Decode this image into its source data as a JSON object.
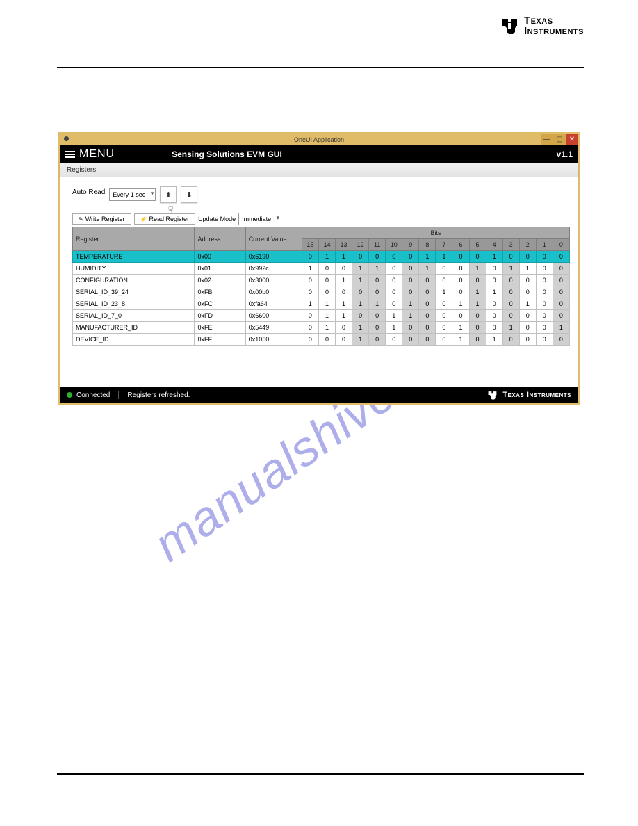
{
  "brand": {
    "line1": "Texas",
    "line2": "Instruments",
    "footer": "Texas Instruments"
  },
  "watermark": "manualshive.com",
  "window_title": "OneUI Application",
  "app_header": {
    "menu": "MENU",
    "title": "Sensing Solutions EVM GUI",
    "version": "v1.1"
  },
  "subheader": "Registers",
  "controls": {
    "autoread_label": "Auto Read",
    "autoread_value": "Every 1 sec",
    "write_btn": "Write Register",
    "read_btn": "Read Register",
    "update_mode_label": "Update Mode",
    "update_mode_value": "Immediate"
  },
  "columns": {
    "register": "Register",
    "address": "Address",
    "current": "Current Value",
    "bits": "Bits"
  },
  "bit_numbers": [
    "15",
    "14",
    "13",
    "12",
    "11",
    "10",
    "9",
    "8",
    "7",
    "6",
    "5",
    "4",
    "3",
    "2",
    "1",
    "0"
  ],
  "rows": [
    {
      "name": "TEMPERATURE",
      "addr": "0x00",
      "val": "0x6190",
      "bits": [
        "0",
        "1",
        "1",
        "0",
        "0",
        "0",
        "0",
        "1",
        "1",
        "0",
        "0",
        "1",
        "0",
        "0",
        "0",
        "0"
      ],
      "hl": true
    },
    {
      "name": "HUMIDITY",
      "addr": "0x01",
      "val": "0x992c",
      "bits": [
        "1",
        "0",
        "0",
        "1",
        "1",
        "0",
        "0",
        "1",
        "0",
        "0",
        "1",
        "0",
        "1",
        "1",
        "0",
        "0"
      ]
    },
    {
      "name": "CONFIGURATION",
      "addr": "0x02",
      "val": "0x3000",
      "bits": [
        "0",
        "0",
        "1",
        "1",
        "0",
        "0",
        "0",
        "0",
        "0",
        "0",
        "0",
        "0",
        "0",
        "0",
        "0",
        "0"
      ]
    },
    {
      "name": "SERIAL_ID_39_24",
      "addr": "0xFB",
      "val": "0x00b0",
      "bits": [
        "0",
        "0",
        "0",
        "0",
        "0",
        "0",
        "0",
        "0",
        "1",
        "0",
        "1",
        "1",
        "0",
        "0",
        "0",
        "0"
      ]
    },
    {
      "name": "SERIAL_ID_23_8",
      "addr": "0xFC",
      "val": "0xfa64",
      "bits": [
        "1",
        "1",
        "1",
        "1",
        "1",
        "0",
        "1",
        "0",
        "0",
        "1",
        "1",
        "0",
        "0",
        "1",
        "0",
        "0"
      ]
    },
    {
      "name": "SERIAL_ID_7_0",
      "addr": "0xFD",
      "val": "0x6600",
      "bits": [
        "0",
        "1",
        "1",
        "0",
        "0",
        "1",
        "1",
        "0",
        "0",
        "0",
        "0",
        "0",
        "0",
        "0",
        "0",
        "0"
      ]
    },
    {
      "name": "MANUFACTURER_ID",
      "addr": "0xFE",
      "val": "0x5449",
      "bits": [
        "0",
        "1",
        "0",
        "1",
        "0",
        "1",
        "0",
        "0",
        "0",
        "1",
        "0",
        "0",
        "1",
        "0",
        "0",
        "1"
      ]
    },
    {
      "name": "DEVICE_ID",
      "addr": "0xFF",
      "val": "0x1050",
      "bits": [
        "0",
        "0",
        "0",
        "1",
        "0",
        "0",
        "0",
        "0",
        "0",
        "1",
        "0",
        "1",
        "0",
        "0",
        "0",
        "0"
      ]
    }
  ],
  "statusbar": {
    "connected": "Connected",
    "message": "Registers refreshed."
  }
}
